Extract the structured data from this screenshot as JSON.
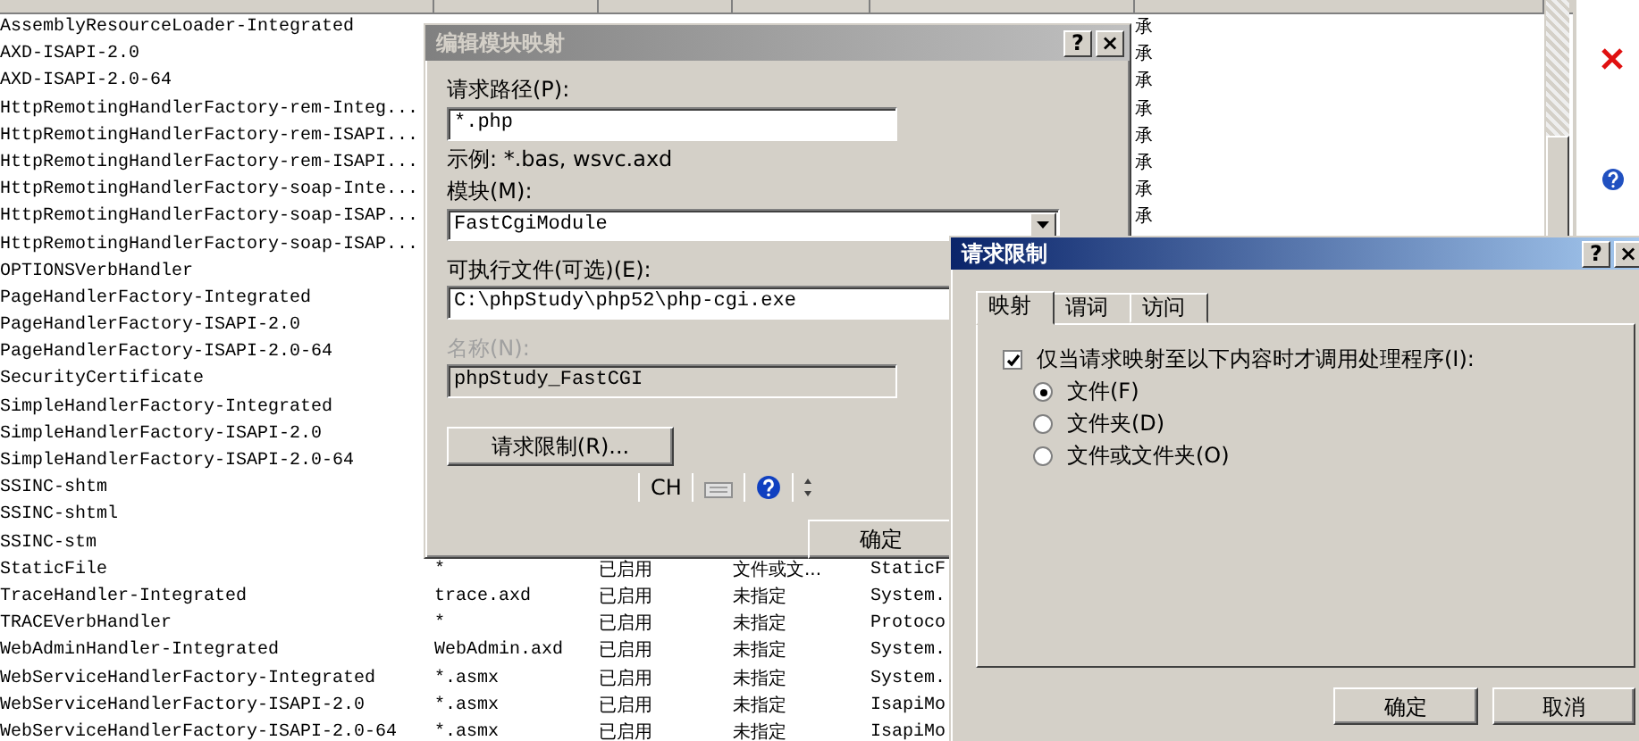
{
  "list": {
    "rows": [
      {
        "name": "AssemblyResourceLoader-Integrated",
        "column_6": "承"
      },
      {
        "name": "AXD-ISAPI-2.0",
        "column_6": "承"
      },
      {
        "name": "AXD-ISAPI-2.0-64",
        "column_6": "承"
      },
      {
        "name": "HttpRemotingHandlerFactory-rem-Integ...",
        "column_6": "承"
      },
      {
        "name": "HttpRemotingHandlerFactory-rem-ISAPI...",
        "column_6": "承"
      },
      {
        "name": "HttpRemotingHandlerFactory-rem-ISAPI...",
        "column_6": "承"
      },
      {
        "name": "HttpRemotingHandlerFactory-soap-Inte...",
        "column_6": "承"
      },
      {
        "name": "HttpRemotingHandlerFactory-soap-ISAP...",
        "column_6": "承"
      },
      {
        "name": "HttpRemotingHandlerFactory-soap-ISAP..."
      },
      {
        "name": "OPTIONSVerbHandler"
      },
      {
        "name": "PageHandlerFactory-Integrated"
      },
      {
        "name": "PageHandlerFactory-ISAPI-2.0"
      },
      {
        "name": "PageHandlerFactory-ISAPI-2.0-64"
      },
      {
        "name": "SecurityCertificate"
      },
      {
        "name": "SimpleHandlerFactory-Integrated"
      },
      {
        "name": "SimpleHandlerFactory-ISAPI-2.0"
      },
      {
        "name": "SimpleHandlerFactory-ISAPI-2.0-64"
      },
      {
        "name": "SSINC-shtm"
      },
      {
        "name": "SSINC-shtml"
      },
      {
        "name": "SSINC-stm"
      },
      {
        "name": "StaticFile",
        "path": "*",
        "state": "已启用",
        "path_type": "文件或文...",
        "handler": "StaticF"
      },
      {
        "name": "TraceHandler-Integrated",
        "path": "trace.axd",
        "state": "已启用",
        "path_type": "未指定",
        "handler": "System."
      },
      {
        "name": "TRACEVerbHandler",
        "path": "*",
        "state": "已启用",
        "path_type": "未指定",
        "handler": "Protoco"
      },
      {
        "name": "WebAdminHandler-Integrated",
        "path": "WebAdmin.axd",
        "state": "已启用",
        "path_type": "未指定",
        "handler": "System."
      },
      {
        "name": "WebServiceHandlerFactory-Integrated",
        "path": "*.asmx",
        "state": "已启用",
        "path_type": "未指定",
        "handler": "System."
      },
      {
        "name": "WebServiceHandlerFactory-ISAPI-2.0",
        "path": "*.asmx",
        "state": "已启用",
        "path_type": "未指定",
        "handler": "IsapiMo"
      },
      {
        "name": "WebServiceHandlerFactory-ISAPI-2.0-64",
        "path": "*.asmx",
        "state": "已启用",
        "path_type": "未指定",
        "handler": "IsapiMo"
      }
    ]
  },
  "edit_dialog": {
    "title": "编辑模块映射",
    "active": false,
    "help_button": "?",
    "close_button": "×",
    "request_path": {
      "label": "请求路径(P):",
      "value": "*.php",
      "hint": "示例: *.bas, wsvc.axd"
    },
    "module": {
      "label": "模块(M):",
      "value": "FastCgiModule"
    },
    "executable": {
      "label": "可执行文件(可选)(E):",
      "value": "C:\\phpStudy\\php52\\php-cgi.exe"
    },
    "name": {
      "label": "名称(N):",
      "value": "phpStudy_FastCGI",
      "disabled": true
    },
    "restrict_button": "请求限制(R)...",
    "ime_bar": {
      "mode": "CH"
    },
    "ok_button": "确定"
  },
  "restrict_dialog": {
    "title": "请求限制",
    "active": true,
    "help_button": "?",
    "close_button": "×",
    "tabs": [
      {
        "label": "映射",
        "selected": true
      },
      {
        "label": "谓词",
        "selected": false
      },
      {
        "label": "访问",
        "selected": false
      }
    ],
    "invoke_only": {
      "label": "仅当请求映射至以下内容时才调用处理程序(I):",
      "checked": true
    },
    "options": [
      {
        "label": "文件(F)",
        "selected": true
      },
      {
        "label": "文件夹(D)",
        "selected": false
      },
      {
        "label": "文件或文件夹(O)",
        "selected": false
      }
    ],
    "buttons": [
      "确定",
      "取消"
    ]
  }
}
